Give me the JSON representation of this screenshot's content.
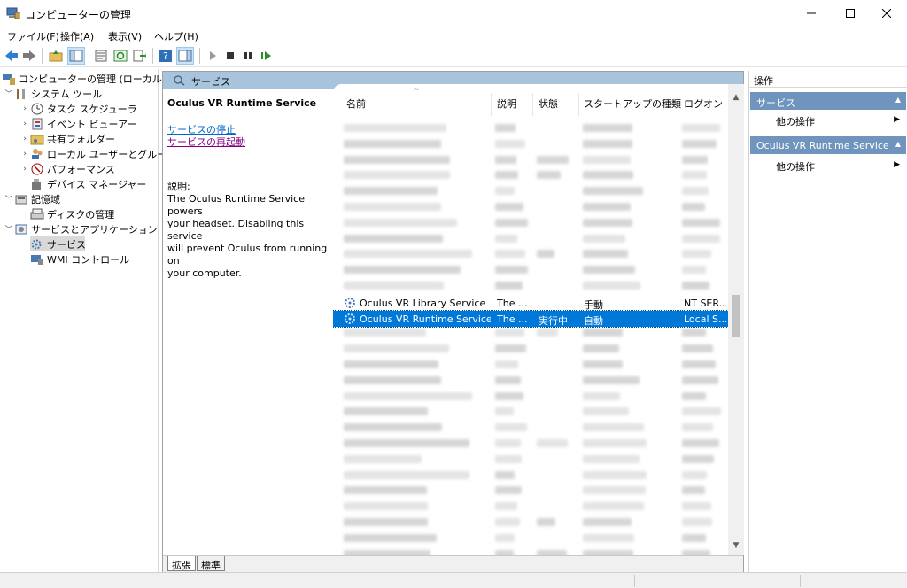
{
  "window": {
    "title": "コンピューターの管理"
  },
  "menu": [
    "ファイル(F)",
    "操作(A)",
    "表示(V)",
    "ヘルプ(H)"
  ],
  "tree": {
    "root": "コンピューターの管理 (ローカル)",
    "system_tools": "システム ツール",
    "task_scheduler": "タスク スケジューラ",
    "event_viewer": "イベント ビューアー",
    "shared_folders": "共有フォルダー",
    "local_users": "ローカル ユーザーとグループ",
    "performance": "パフォーマンス",
    "device_manager": "デバイス マネージャー",
    "storage": "記憶域",
    "disk_management": "ディスクの管理",
    "services_apps": "サービスとアプリケーション",
    "services": "サービス",
    "wmi": "WMI コントロール"
  },
  "center": {
    "header": "サービス",
    "selected_service": "Oculus VR Runtime Service",
    "stop_link": "サービスの停止",
    "restart_link": "サービスの再起動",
    "description_label": "説明:",
    "description_lines": [
      "The Oculus Runtime Service powers",
      "your headset. Disabling this service",
      "will prevent Oculus from running on",
      "your computer."
    ]
  },
  "list": {
    "columns": [
      "名前",
      "説明",
      "状態",
      "スタートアップの種類",
      "ログオン"
    ],
    "rows": [
      {
        "name": "Oculus VR Library Service",
        "desc": "The ...",
        "status": "",
        "startup": "手動",
        "logon": "NT SER..."
      },
      {
        "name": "Oculus VR Runtime Service",
        "desc": "The ...",
        "status": "実行中",
        "startup": "自動",
        "logon": "Local S..."
      }
    ]
  },
  "tabs": [
    "拡張",
    "標準"
  ],
  "actions": {
    "title": "操作",
    "group1": "サービス",
    "group1_item": "他の操作",
    "group2": "Oculus VR Runtime Service",
    "group2_item": "他の操作"
  },
  "colors": {
    "selection": "#0078d7",
    "header_band": "#a8c3dc",
    "action_group": "#6f95be",
    "link": "#0066cc",
    "visited_link": "#800080"
  }
}
